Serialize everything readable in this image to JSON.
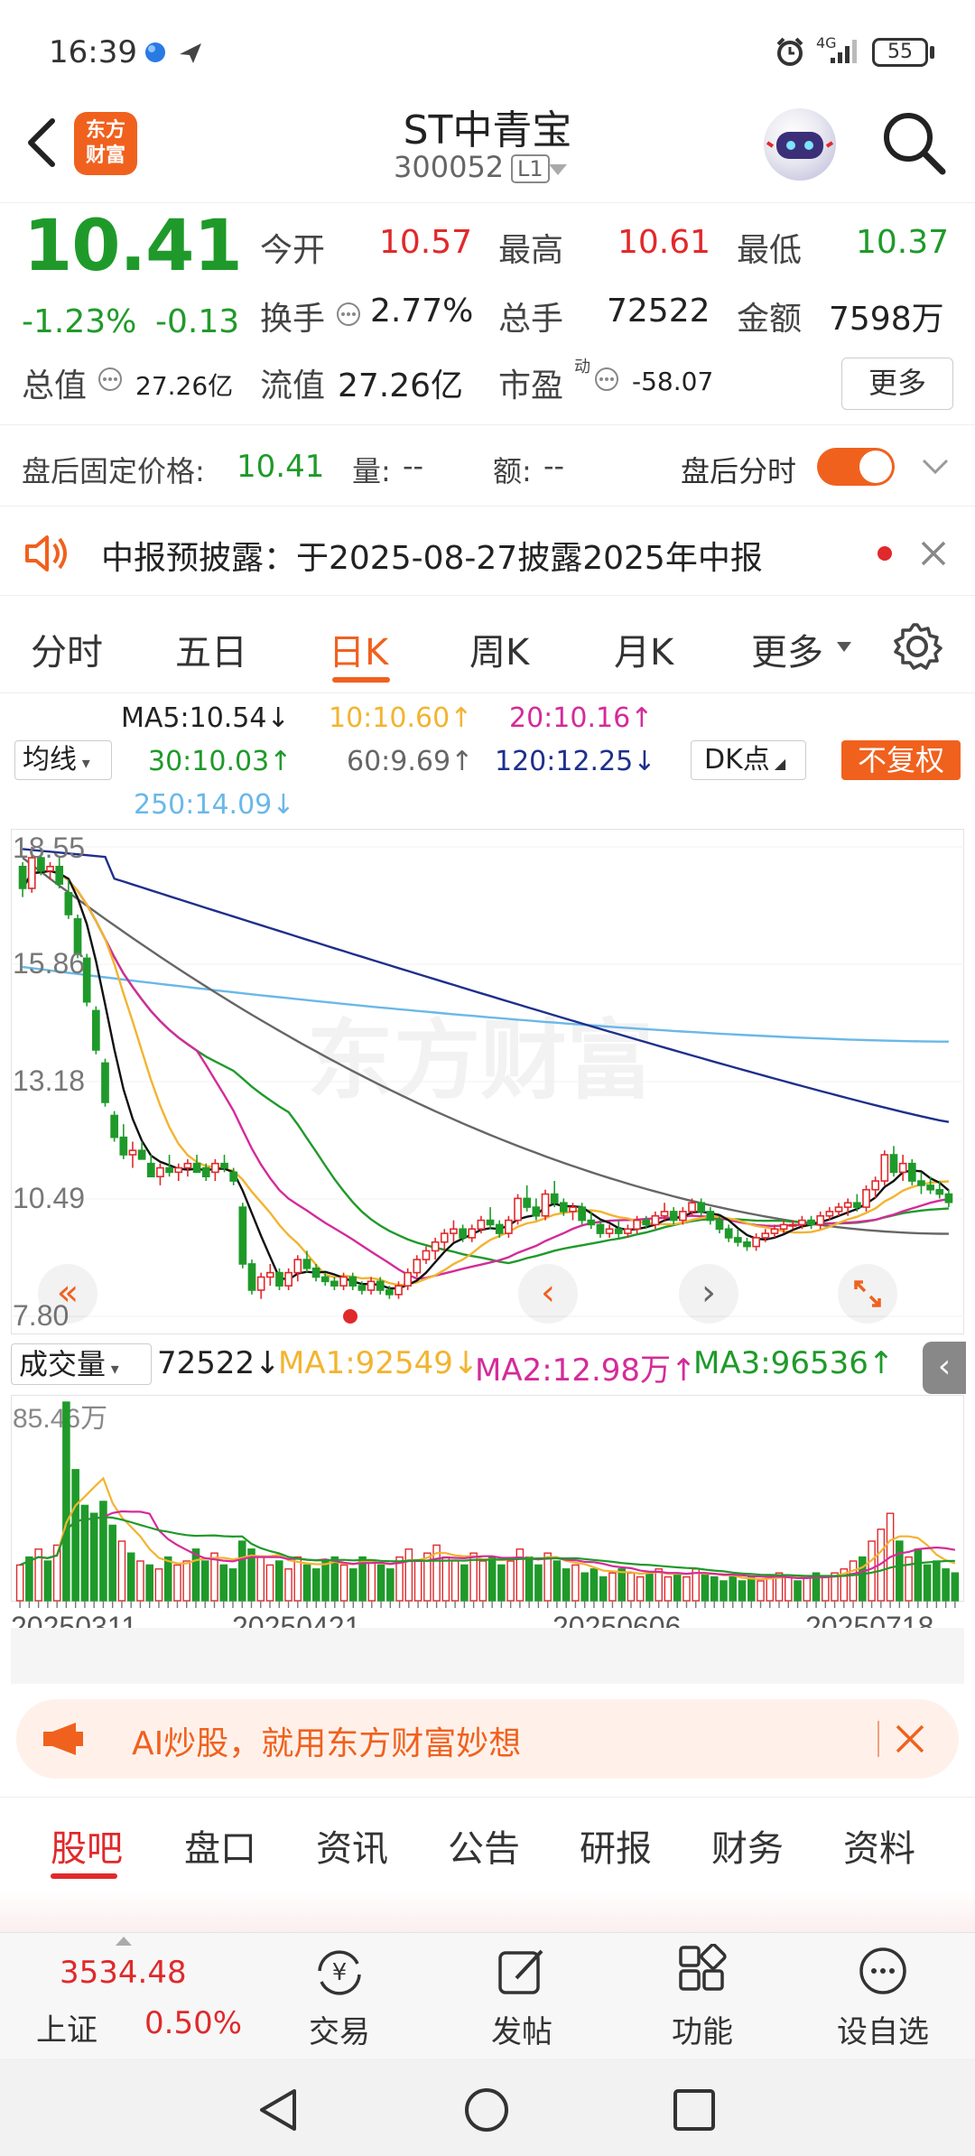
{
  "status": {
    "time": "16:39",
    "network": "4G",
    "battery": "55"
  },
  "header": {
    "logo_line1": "东方",
    "logo_line2": "财富",
    "title": "ST中青宝",
    "code": "300052",
    "level": "L1"
  },
  "quote": {
    "price": "10.41",
    "change_pct": "-1.23%",
    "change": "-0.13",
    "open_label": "今开",
    "open": "10.57",
    "high_label": "最高",
    "high": "10.61",
    "low_label": "最低",
    "low": "10.37",
    "turnover_label": "换手",
    "turnover": "2.77%",
    "volume_label": "总手",
    "volume": "72522",
    "amount_label": "金额",
    "amount": "7598万",
    "mktcap_label": "总值",
    "mktcap": "27.26亿",
    "float_label": "流值",
    "float": "27.26亿",
    "pe_label": "市盈",
    "pe_sup": "动",
    "pe": "-58.07",
    "more": "更多"
  },
  "after_hours": {
    "label": "盘后固定价格:",
    "price": "10.41",
    "vol_label": "量:",
    "vol": "--",
    "amt_label": "额:",
    "amt": "--",
    "toggle_label": "盘后分时"
  },
  "notice": {
    "text": "中报预披露：于2025-08-27披露2025年中报"
  },
  "chart_tabs": [
    "分时",
    "五日",
    "日K",
    "周K",
    "月K",
    "更多"
  ],
  "active_chart_tab": 2,
  "ma_legend": {
    "ma5": "MA5:10.54",
    "ma10": "10:10.60",
    "ma20": "20:10.16",
    "ma30": "30:10.03",
    "ma60": "60:9.69",
    "ma120": "120:12.25",
    "ma250": "250:14.09",
    "selector": "均线",
    "dk": "DK点",
    "fuquan": "不复权"
  },
  "colors": {
    "ma5": "#111111",
    "ma10": "#f2b430",
    "ma20": "#d42b9a",
    "ma30": "#1f9a2a",
    "ma60": "#666666",
    "ma120": "#1e2f8c",
    "ma250": "#6ab8e8",
    "up": "#e0292b",
    "down": "#1f9a2a",
    "accent": "#f0611e"
  },
  "chart_data": {
    "type": "candlestick",
    "y_ticks": [
      "18.55",
      "15.86",
      "13.18",
      "10.49",
      "7.80"
    ],
    "ylim": [
      7.8,
      18.55
    ],
    "x_ticks": [
      "20250311",
      "20250421",
      "20250606",
      "20250718"
    ],
    "candles": [
      [
        18.1,
        18.2,
        17.4,
        17.6
      ],
      [
        17.6,
        18.55,
        17.5,
        18.3
      ],
      [
        18.3,
        18.4,
        17.9,
        18.0
      ],
      [
        18.0,
        18.2,
        17.8,
        18.1
      ],
      [
        18.1,
        18.3,
        17.6,
        17.7
      ],
      [
        17.5,
        17.8,
        16.9,
        17.0
      ],
      [
        16.9,
        17.0,
        16.0,
        16.1
      ],
      [
        16.0,
        16.1,
        14.9,
        15.0
      ],
      [
        14.8,
        14.9,
        13.8,
        13.9
      ],
      [
        13.6,
        13.7,
        12.6,
        12.7
      ],
      [
        12.4,
        12.5,
        11.8,
        11.9
      ],
      [
        11.9,
        12.2,
        11.4,
        11.5
      ],
      [
        11.5,
        11.8,
        11.2,
        11.6
      ],
      [
        11.6,
        11.8,
        11.4,
        11.4
      ],
      [
        11.3,
        11.5,
        11.0,
        11.0
      ],
      [
        11.0,
        11.3,
        10.8,
        11.2
      ],
      [
        11.2,
        11.5,
        11.0,
        11.1
      ],
      [
        11.1,
        11.3,
        10.9,
        11.2
      ],
      [
        11.2,
        11.4,
        11.0,
        11.3
      ],
      [
        11.3,
        11.5,
        11.1,
        11.1
      ],
      [
        11.2,
        11.3,
        10.9,
        11.0
      ],
      [
        11.1,
        11.4,
        10.9,
        11.3
      ],
      [
        11.3,
        11.5,
        11.1,
        11.2
      ],
      [
        11.1,
        11.2,
        10.8,
        10.9
      ],
      [
        10.3,
        10.4,
        8.9,
        9.0
      ],
      [
        9.0,
        9.1,
        8.3,
        8.4
      ],
      [
        8.4,
        8.8,
        8.2,
        8.7
      ],
      [
        8.7,
        9.0,
        8.5,
        8.8
      ],
      [
        8.8,
        8.9,
        8.4,
        8.5
      ],
      [
        8.5,
        8.9,
        8.4,
        8.8
      ],
      [
        8.8,
        9.2,
        8.6,
        9.1
      ],
      [
        9.1,
        9.3,
        8.8,
        8.9
      ],
      [
        8.9,
        9.0,
        8.6,
        8.7
      ],
      [
        8.7,
        8.8,
        8.5,
        8.6
      ],
      [
        8.6,
        8.7,
        8.4,
        8.5
      ],
      [
        8.5,
        8.8,
        8.4,
        8.7
      ],
      [
        8.7,
        8.8,
        8.4,
        8.5
      ],
      [
        8.5,
        8.6,
        8.3,
        8.4
      ],
      [
        8.4,
        8.7,
        8.3,
        8.6
      ],
      [
        8.6,
        8.7,
        8.3,
        8.4
      ],
      [
        8.4,
        8.5,
        8.2,
        8.3
      ],
      [
        8.3,
        8.6,
        8.2,
        8.5
      ],
      [
        8.5,
        8.9,
        8.4,
        8.8
      ],
      [
        8.8,
        9.2,
        8.7,
        9.1
      ],
      [
        9.1,
        9.4,
        9.0,
        9.3
      ],
      [
        9.3,
        9.6,
        9.1,
        9.5
      ],
      [
        9.5,
        9.8,
        9.3,
        9.7
      ],
      [
        9.7,
        10.0,
        9.5,
        9.8
      ],
      [
        9.8,
        9.9,
        9.5,
        9.6
      ],
      [
        9.6,
        9.9,
        9.5,
        9.8
      ],
      [
        9.8,
        10.1,
        9.7,
        10.0
      ],
      [
        10.0,
        10.3,
        9.8,
        9.9
      ],
      [
        9.9,
        10.0,
        9.6,
        9.7
      ],
      [
        9.7,
        10.1,
        9.6,
        10.0
      ],
      [
        10.0,
        10.6,
        9.9,
        10.5
      ],
      [
        10.5,
        10.8,
        10.2,
        10.3
      ],
      [
        10.3,
        10.5,
        10.0,
        10.1
      ],
      [
        10.1,
        10.7,
        10.0,
        10.6
      ],
      [
        10.6,
        10.9,
        10.3,
        10.4
      ],
      [
        10.4,
        10.5,
        10.1,
        10.2
      ],
      [
        10.2,
        10.4,
        10.0,
        10.3
      ],
      [
        10.3,
        10.4,
        9.9,
        10.0
      ],
      [
        10.0,
        10.2,
        9.8,
        9.9
      ],
      [
        9.9,
        10.0,
        9.6,
        9.7
      ],
      [
        9.7,
        9.9,
        9.6,
        9.8
      ],
      [
        9.8,
        10.0,
        9.6,
        9.7
      ],
      [
        9.7,
        9.9,
        9.6,
        9.8
      ],
      [
        9.8,
        10.1,
        9.7,
        10.0
      ],
      [
        10.0,
        10.1,
        9.8,
        9.9
      ],
      [
        9.9,
        10.2,
        9.8,
        10.1
      ],
      [
        10.1,
        10.4,
        10.0,
        10.2
      ],
      [
        10.2,
        10.3,
        9.9,
        10.0
      ],
      [
        10.0,
        10.3,
        9.9,
        10.2
      ],
      [
        10.2,
        10.5,
        10.1,
        10.4
      ],
      [
        10.4,
        10.5,
        10.1,
        10.2
      ],
      [
        10.2,
        10.3,
        9.9,
        10.0
      ],
      [
        10.0,
        10.1,
        9.7,
        9.8
      ],
      [
        9.8,
        9.9,
        9.5,
        9.6
      ],
      [
        9.6,
        9.8,
        9.4,
        9.5
      ],
      [
        9.5,
        9.6,
        9.3,
        9.4
      ],
      [
        9.4,
        9.7,
        9.3,
        9.6
      ],
      [
        9.6,
        9.8,
        9.5,
        9.7
      ],
      [
        9.7,
        9.9,
        9.6,
        9.8
      ],
      [
        9.8,
        10.0,
        9.7,
        9.9
      ],
      [
        9.9,
        10.0,
        9.8,
        9.9
      ],
      [
        9.9,
        10.1,
        9.8,
        10.0
      ],
      [
        10.0,
        10.1,
        9.8,
        9.9
      ],
      [
        9.9,
        10.2,
        9.8,
        10.1
      ],
      [
        10.1,
        10.3,
        10.0,
        10.2
      ],
      [
        10.2,
        10.4,
        10.1,
        10.3
      ],
      [
        10.3,
        10.5,
        10.1,
        10.4
      ],
      [
        10.4,
        10.6,
        10.2,
        10.3
      ],
      [
        10.3,
        10.8,
        10.2,
        10.7
      ],
      [
        10.7,
        11.0,
        10.5,
        10.9
      ],
      [
        10.9,
        11.6,
        10.8,
        11.5
      ],
      [
        11.5,
        11.7,
        11.0,
        11.1
      ],
      [
        11.1,
        11.5,
        10.9,
        11.3
      ],
      [
        11.3,
        11.4,
        10.8,
        10.9
      ],
      [
        10.9,
        11.1,
        10.6,
        10.8
      ],
      [
        10.8,
        11.0,
        10.6,
        10.7
      ],
      [
        10.7,
        10.9,
        10.5,
        10.6
      ],
      [
        10.6,
        10.7,
        10.3,
        10.41
      ]
    ]
  },
  "volume": {
    "selector": "成交量",
    "current": "72522",
    "ma1": "MA1:92549",
    "ma2": "MA2:12.98万",
    "ma3": "MA3:96536",
    "ymax_label": "85.46万",
    "ma1_color": "#f2b430",
    "ma2_color": "#d42b9a",
    "ma3_color": "#1f9a2a",
    "bars": [
      0.18,
      0.22,
      0.26,
      0.2,
      0.28,
      1.0,
      0.66,
      0.48,
      0.44,
      0.5,
      0.38,
      0.3,
      0.24,
      0.2,
      0.18,
      0.16,
      0.22,
      0.18,
      0.2,
      0.26,
      0.2,
      0.24,
      0.18,
      0.16,
      0.3,
      0.26,
      0.22,
      0.18,
      0.2,
      0.16,
      0.22,
      0.18,
      0.16,
      0.2,
      0.22,
      0.18,
      0.16,
      0.22,
      0.2,
      0.18,
      0.16,
      0.22,
      0.26,
      0.2,
      0.24,
      0.28,
      0.22,
      0.2,
      0.18,
      0.24,
      0.2,
      0.22,
      0.18,
      0.2,
      0.26,
      0.22,
      0.18,
      0.24,
      0.2,
      0.16,
      0.18,
      0.14,
      0.16,
      0.12,
      0.14,
      0.16,
      0.14,
      0.12,
      0.14,
      0.16,
      0.12,
      0.14,
      0.12,
      0.16,
      0.14,
      0.12,
      0.1,
      0.12,
      0.1,
      0.12,
      0.1,
      0.12,
      0.14,
      0.12,
      0.1,
      0.12,
      0.14,
      0.12,
      0.14,
      0.16,
      0.2,
      0.22,
      0.3,
      0.36,
      0.44,
      0.3,
      0.22,
      0.26,
      0.18,
      0.2,
      0.16,
      0.14
    ],
    "up_flags": [
      1,
      0,
      1,
      0,
      1,
      0,
      0,
      0,
      0,
      0,
      0,
      1,
      0,
      1,
      0,
      1,
      0,
      1,
      1,
      0,
      0,
      1,
      0,
      0,
      0,
      0,
      1,
      1,
      0,
      1,
      1,
      0,
      0,
      0,
      0,
      1,
      0,
      0,
      1,
      0,
      0,
      1,
      1,
      1,
      1,
      1,
      1,
      1,
      0,
      1,
      1,
      0,
      0,
      1,
      1,
      0,
      0,
      1,
      0,
      0,
      1,
      0,
      0,
      0,
      1,
      0,
      1,
      1,
      0,
      1,
      1,
      0,
      1,
      1,
      0,
      0,
      0,
      0,
      0,
      0,
      1,
      1,
      1,
      1,
      0,
      1,
      0,
      1,
      1,
      1,
      1,
      0,
      1,
      1,
      1,
      0,
      1,
      0,
      0,
      0,
      0,
      0
    ]
  },
  "ad": {
    "text": "AI炒股，就用东方财富妙想"
  },
  "bottom_tabs": [
    "股吧",
    "盘口",
    "资讯",
    "公告",
    "研报",
    "财务",
    "资料"
  ],
  "index": {
    "value": "3534.48",
    "name": "上证",
    "pct": "0.50%"
  },
  "bottom_nav": [
    "交易",
    "发帖",
    "功能",
    "设自选"
  ],
  "watermark": "东方财富"
}
